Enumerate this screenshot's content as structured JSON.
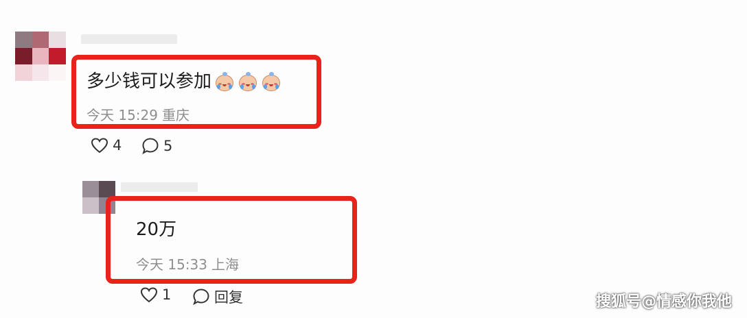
{
  "comment": {
    "text": "多少钱可以参加",
    "emoji_icon": "crying-face-emoji",
    "time": "今天 15:29",
    "location": "重庆",
    "likes": "4",
    "replies_count": "5"
  },
  "reply": {
    "text": "20万",
    "time": "今天 15:33",
    "location": "上海",
    "likes": "1",
    "reply_label": "回复"
  },
  "highlight_color": "#e8231b",
  "watermark": "搜狐号@情感你我他"
}
